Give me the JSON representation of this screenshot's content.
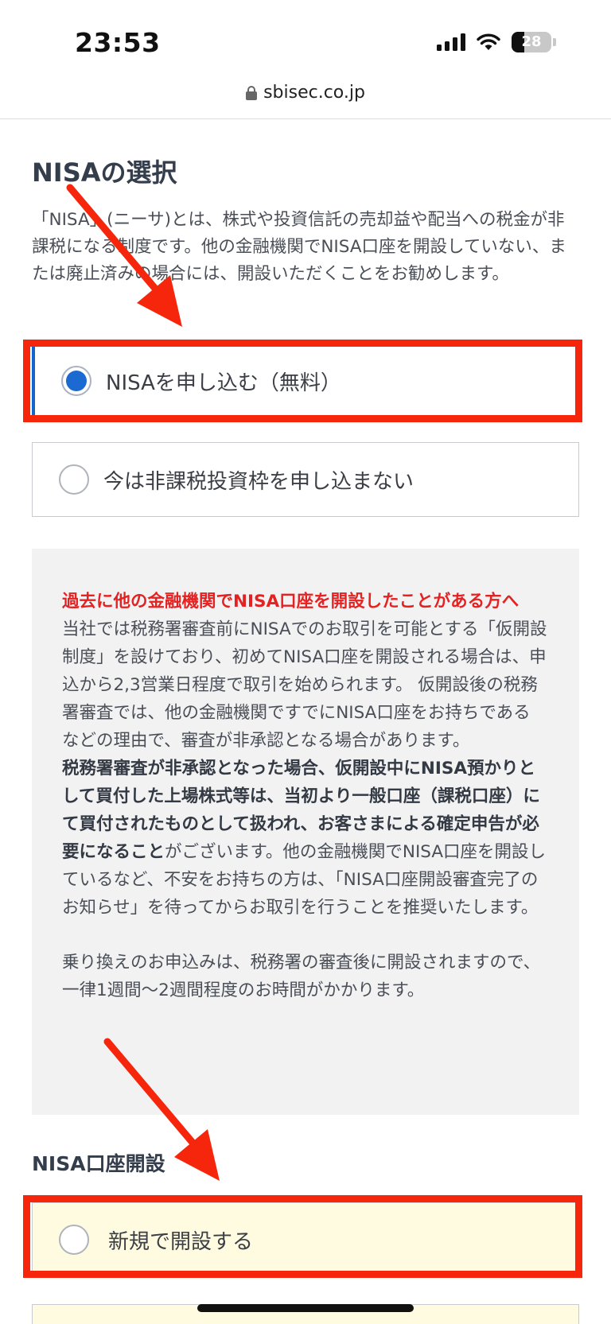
{
  "status_bar": {
    "time": "23:53",
    "battery": "28"
  },
  "url_bar": {
    "domain": "sbisec.co.jp"
  },
  "nisa_selection": {
    "title": "NISAの選択",
    "description": "「NISA」(ニーサ)とは、株式や投資信託の売却益や配当への税金が非課税になる制度です。他の金融機関でNISA口座を開設していない、または廃止済みの場合には、開設いただくことをお勧めします。",
    "options": [
      {
        "label": "NISAを申し込む（無料）",
        "selected": true
      },
      {
        "label": "今は非課税投資枠を申し込まない",
        "selected": false
      }
    ]
  },
  "notice": {
    "title": "過去に他の金融機関でNISA口座を開設したことがある方へ",
    "para1": "当社では税務署審査前にNISAでのお取引を可能とする「仮開設制度」を設けており、初めてNISA口座を開設される場合は、申込から2,3営業日程度で取引を始められます。 仮開設後の税務署審査では、他の金融機関ですでにNISA口座をお持ちであるなどの理由で、審査が非承認となる場合があります。",
    "para2_bold": "税務署審査が非承認となった場合、仮開設中にNISA預かりとして買付した上場株式等は、当初より一般口座（課税口座）にて買付されたものとして扱われ、お客さまによる確定申告が必要になること",
    "para2_rest": "がございます。他の金融機関でNISA口座を開設しているなど、不安をお持ちの方は、「NISA口座開設審査完了のお知らせ」を待ってからお取引を行うことを推奨いたします。",
    "para3": "乗り換えのお申込みは、税務署の審査後に開設されますので、一律1週間〜2週間程度のお時間がかかります。"
  },
  "nisa_account": {
    "title": "NISA口座開設",
    "options": [
      {
        "label": "新規で開設する",
        "selected": false
      }
    ]
  },
  "colors": {
    "accent": "#1b6ad2",
    "annotation_red": "#f5260b",
    "warning_red": "#e52222"
  }
}
